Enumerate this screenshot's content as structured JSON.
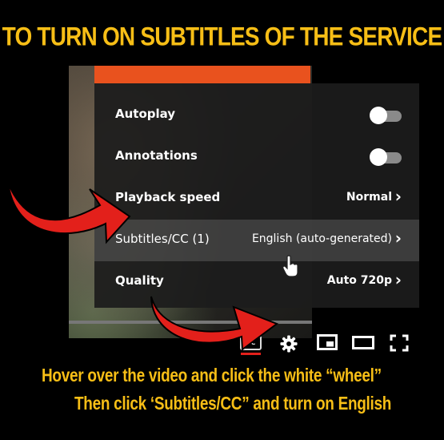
{
  "headline": "TO TURN ON SUBTITLES OF THE SERVICE",
  "settings_menu": {
    "items": [
      {
        "label": "Autoplay",
        "control": "toggle",
        "state": "off"
      },
      {
        "label": "Annotations",
        "control": "toggle",
        "state": "off"
      },
      {
        "label": "Playback speed",
        "value": "Normal",
        "chevron": "›"
      },
      {
        "label": "Subtitles/CC (1)",
        "value": "English (auto-generated)",
        "chevron": "›",
        "highlighted": true
      },
      {
        "label": "Quality",
        "value": "Auto 720p",
        "chevron": "›"
      }
    ]
  },
  "player_controls": {
    "cc_text": "CC",
    "icons": [
      "cc-icon",
      "gear-icon",
      "miniplayer-icon",
      "theater-mode-icon",
      "fullscreen-icon"
    ]
  },
  "captions": {
    "line1": "Hover over the video and click the white “wheel”",
    "line2": "Then click ‘Subtitles/CC” and turn on English"
  },
  "colors": {
    "headline": "#f7be16",
    "arrow": "#e3201b",
    "progress_accent": "#e9521e",
    "menu_background": "#1c1c1c"
  }
}
